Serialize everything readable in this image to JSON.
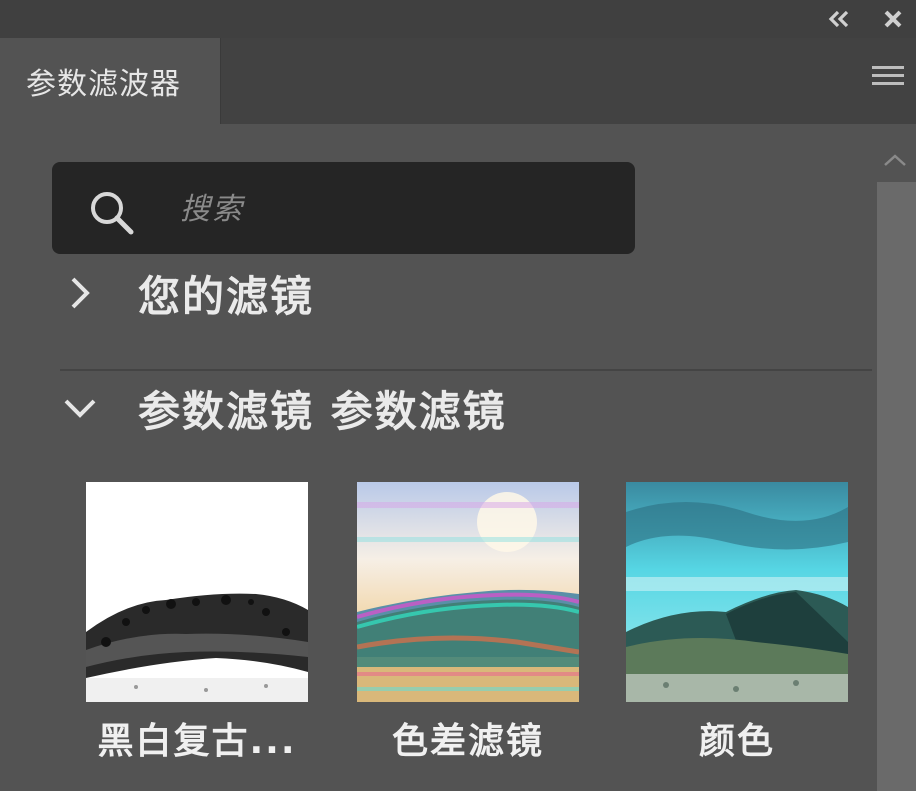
{
  "window": {
    "collapse_icon": "double-chevron-left-icon",
    "close_icon": "close-icon"
  },
  "tab": {
    "label": "参数滤波器",
    "menu_icon": "hamburger-menu-icon"
  },
  "search": {
    "placeholder": "搜索",
    "icon": "search-icon"
  },
  "sections": [
    {
      "title": "您的滤镜",
      "state": "collapsed",
      "icon": "chevron-right-icon"
    },
    {
      "title": "参数滤镜 参数滤镜",
      "state": "expanded",
      "icon": "chevron-down-icon"
    }
  ],
  "filters": [
    {
      "label": "黑白复古...",
      "thumbnail": "black-and-white-mountain"
    },
    {
      "label": "色差滤镜",
      "thumbnail": "chromatic-aberration-mountain"
    },
    {
      "label": "颜色",
      "thumbnail": "cyan-tinted-mountain"
    }
  ],
  "colors": {
    "panel_bg": "#535353",
    "topbar_bg": "#404040",
    "search_bg": "#252525",
    "text": "#eaeaea"
  }
}
